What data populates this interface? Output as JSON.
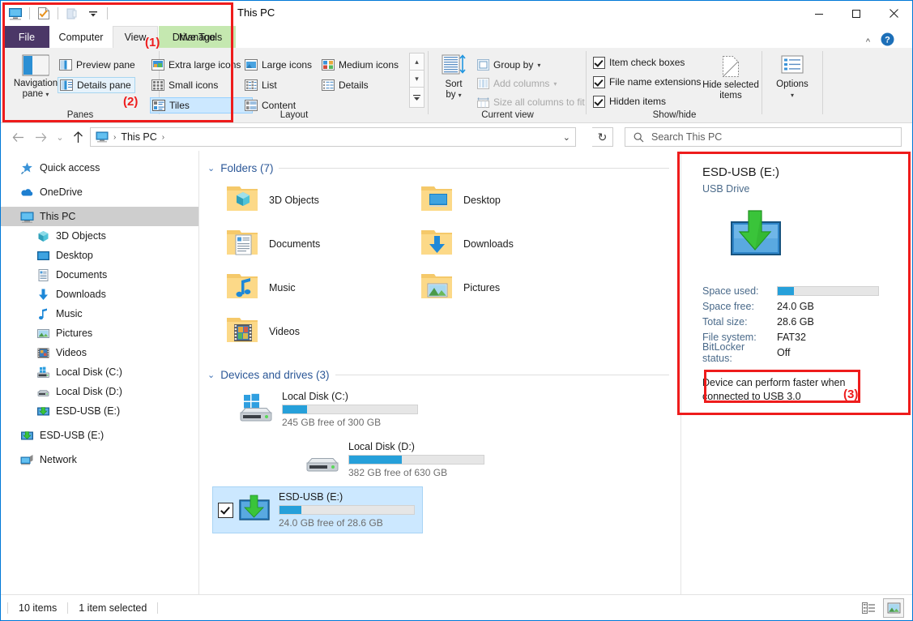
{
  "window": {
    "title": "This PC",
    "minimize_label": "Minimize",
    "maximize_label": "Maximize",
    "close_label": "Close",
    "ribbon_collapse_label": "Collapse the Ribbon",
    "help_label": "Help"
  },
  "quick_access_toolbar": {
    "items": [
      {
        "name": "properties-pc-icon",
        "label": "This PC"
      },
      {
        "name": "properties-icon",
        "label": "Properties"
      },
      {
        "name": "new-folder-icon",
        "label": "New folder"
      },
      {
        "name": "customize-dropdown-icon",
        "label": "Customize Quick Access Toolbar"
      }
    ]
  },
  "ribbon": {
    "contextual_tab_header": "Manage",
    "tabs": [
      {
        "label": "File",
        "active": false
      },
      {
        "label": "Computer",
        "active": false
      },
      {
        "label": "View",
        "active": true
      },
      {
        "label": "Drive Tools",
        "active": false
      }
    ],
    "groups": {
      "panes": {
        "label": "Panes",
        "navigation_pane": "Navigation\npane",
        "navigation_pane_line1": "Navigation",
        "navigation_pane_line2": "pane",
        "preview_pane": "Preview pane",
        "details_pane": "Details pane"
      },
      "layout": {
        "label": "Layout",
        "items": [
          "Extra large icons",
          "Large icons",
          "Medium icons",
          "Small icons",
          "List",
          "Details",
          "Tiles",
          "Content"
        ],
        "selected": "Tiles",
        "scroll_up": "▴",
        "scroll_down": "▾",
        "more": "▾"
      },
      "current_view": {
        "label": "Current view",
        "sort_by_line1": "Sort",
        "sort_by_line2": "by",
        "group_by": "Group by",
        "add_columns": "Add columns",
        "size_all_columns": "Size all columns to fit"
      },
      "show_hide": {
        "label": "Show/hide",
        "item_check_boxes": "Item check boxes",
        "file_name_extensions": "File name extensions",
        "hidden_items": "Hidden items",
        "hide_selected_line1": "Hide selected",
        "hide_selected_line2": "items"
      },
      "options": {
        "label": "Options"
      }
    }
  },
  "addressbar": {
    "back": "←",
    "forward": "→",
    "recent_dropdown": "⌄",
    "up": "↑",
    "breadcrumb": [
      "This PC"
    ],
    "breadcrumb_sep": "›",
    "history_dropdown": "⌄",
    "refresh": "↻",
    "search_placeholder": "Search This PC"
  },
  "navigation_pane": {
    "items": [
      {
        "label": "Quick access",
        "icon": "star-pin-icon",
        "indent": false,
        "active": false,
        "spacer_after": true
      },
      {
        "label": "OneDrive",
        "icon": "cloud-icon",
        "indent": false,
        "active": false,
        "spacer_after": true
      },
      {
        "label": "This PC",
        "icon": "monitor-icon",
        "indent": false,
        "active": true,
        "spacer_after": false
      },
      {
        "label": "3D Objects",
        "icon": "cube-icon",
        "indent": true,
        "active": false,
        "spacer_after": false
      },
      {
        "label": "Desktop",
        "icon": "desktop-icon",
        "indent": true,
        "active": false,
        "spacer_after": false
      },
      {
        "label": "Documents",
        "icon": "document-icon",
        "indent": true,
        "active": false,
        "spacer_after": false
      },
      {
        "label": "Downloads",
        "icon": "download-arrow-icon",
        "indent": true,
        "active": false,
        "spacer_after": false
      },
      {
        "label": "Music",
        "icon": "music-note-icon",
        "indent": true,
        "active": false,
        "spacer_after": false
      },
      {
        "label": "Pictures",
        "icon": "picture-icon",
        "indent": true,
        "active": false,
        "spacer_after": false
      },
      {
        "label": "Videos",
        "icon": "film-icon",
        "indent": true,
        "active": false,
        "spacer_after": false
      },
      {
        "label": "Local Disk (C:)",
        "icon": "windows-drive-icon",
        "indent": true,
        "active": false,
        "spacer_after": false
      },
      {
        "label": "Local Disk (D:)",
        "icon": "drive-icon",
        "indent": true,
        "active": false,
        "spacer_after": false
      },
      {
        "label": "ESD-USB (E:)",
        "icon": "usb-drive-icon",
        "indent": true,
        "active": false,
        "spacer_after": true
      },
      {
        "label": "ESD-USB (E:)",
        "icon": "usb-drive-icon",
        "indent": false,
        "active": false,
        "spacer_after": true
      },
      {
        "label": "Network",
        "icon": "network-icon",
        "indent": false,
        "active": false,
        "spacer_after": false
      }
    ]
  },
  "content": {
    "folders_group": {
      "header": "Folders (7)",
      "chevron": "⌄",
      "items": [
        {
          "label": "3D Objects",
          "icon": "folder-3dobjects-icon"
        },
        {
          "label": "Desktop",
          "icon": "folder-desktop-icon"
        },
        {
          "label": "Documents",
          "icon": "folder-documents-icon"
        },
        {
          "label": "Downloads",
          "icon": "folder-downloads-icon"
        },
        {
          "label": "Music",
          "icon": "folder-music-icon"
        },
        {
          "label": "Pictures",
          "icon": "folder-pictures-icon"
        },
        {
          "label": "Videos",
          "icon": "folder-videos-icon"
        }
      ]
    },
    "devices_group": {
      "header": "Devices and drives (3)",
      "chevron": "⌄",
      "items": [
        {
          "label": "Local Disk (C:)",
          "icon": "windows-drive-icon",
          "capacity_text": "245 GB free of 300 GB",
          "used_percent": 18,
          "selected": false,
          "checked": false
        },
        {
          "label": "Local Disk (D:)",
          "icon": "drive-icon",
          "capacity_text": "382 GB free of 630 GB",
          "used_percent": 39,
          "selected": false,
          "checked": false
        },
        {
          "label": "ESD-USB (E:)",
          "icon": "usb-drive-icon",
          "capacity_text": "24.0 GB free of 28.6 GB",
          "used_percent": 16,
          "selected": true,
          "checked": true
        }
      ]
    }
  },
  "details_pane": {
    "title": "ESD-USB (E:)",
    "subtitle": "USB Drive",
    "icon": "usb-drive-large-icon",
    "properties": [
      {
        "key": "Space used:",
        "value": "",
        "is_bar": true,
        "used_percent": 16
      },
      {
        "key": "Space free:",
        "value": "24.0 GB",
        "is_bar": false
      },
      {
        "key": "Total size:",
        "value": "28.6 GB",
        "is_bar": false
      },
      {
        "key": "File system:",
        "value": "FAT32",
        "is_bar": false
      },
      {
        "key": "BitLocker status:",
        "value": "Off",
        "is_bar": false
      }
    ],
    "note": "Device can perform faster when connected to USB 3.0"
  },
  "statusbar": {
    "item_count": "10 items",
    "selection": "1 item selected",
    "view_details_label": "Details view",
    "view_large_icons_label": "Large icons view"
  },
  "annotations": [
    {
      "id": "1",
      "label": "(1)"
    },
    {
      "id": "2",
      "label": "(2)"
    },
    {
      "id": "3",
      "label": "(3)"
    }
  ],
  "colors": {
    "accent": "#0078d7",
    "progress": "#26a0da",
    "annotation": "#ee1c1c",
    "file_tab": "#4b3767",
    "contextual_tab": "#c5e8b0",
    "selection": "#cce8ff",
    "group_header": "#2b5797"
  }
}
